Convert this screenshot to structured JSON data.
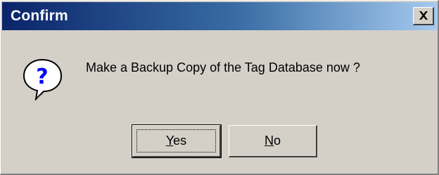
{
  "window": {
    "title": "Confirm",
    "close_icon": "close-x-icon"
  },
  "message": {
    "icon": "question-balloon-icon",
    "text": "Make a Backup Copy of the Tag Database now ?"
  },
  "buttons": {
    "yes": {
      "mnemonic": "Y",
      "rest": "es"
    },
    "no": {
      "mnemonic": "N",
      "rest": "o"
    }
  }
}
